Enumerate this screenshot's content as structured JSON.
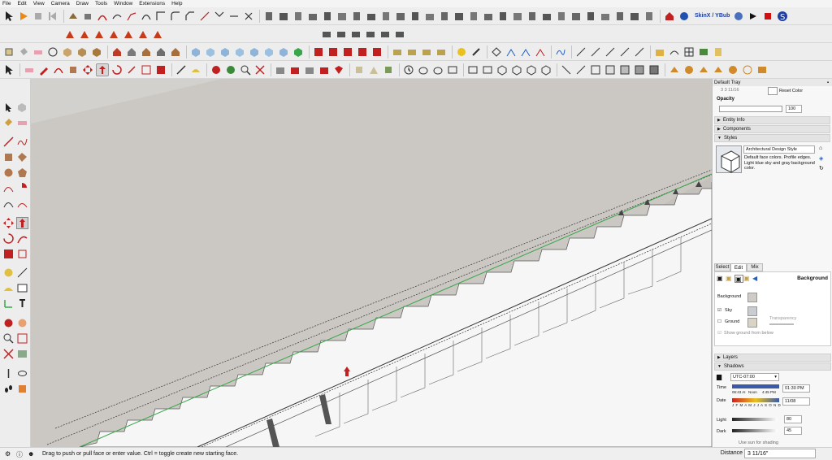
{
  "menu": [
    "File",
    "Edit",
    "View",
    "Camera",
    "Draw",
    "Tools",
    "Window",
    "Extensions",
    "Help"
  ],
  "skin_button": "SkinX / YBub",
  "tray": {
    "title": "Default Tray",
    "reset_color": "Reset Color",
    "opacity_label": "Opacity",
    "opacity_value": "100",
    "entity_info": "Entity Info",
    "components": "Components",
    "styles": "Styles",
    "style_name": "Architectural Design Style",
    "style_desc": "Default face colors. Profile edges. Light blue sky and gray background color.",
    "tabs": [
      "Select",
      "Edit",
      "Mix"
    ],
    "background_label": "Background",
    "bg_row": "Background",
    "sky_row": "Sky",
    "ground_row": "Ground",
    "transparency": "Transparency",
    "show_ground_below": "Show ground from below",
    "layers": "Layers",
    "shadows": "Shadows",
    "timezone": "UTC-07:00",
    "time_label": "Time",
    "time_start": "06:43 AI",
    "time_noon": "Noon",
    "time_end": "4:45 PM",
    "time_value": "01:30 PM",
    "date_label": "Date",
    "months": "J F M A M J J A S O N D",
    "date_value": "11/08",
    "light_label": "Light",
    "light_value": "80",
    "dark_label": "Dark",
    "dark_value": "45",
    "use_sun": "Use sun for shading",
    "fragment": "3 3 11/16"
  },
  "status": {
    "hint": "Drag to push or pull face or enter value.  Ctrl = toggle create new starting face.",
    "measure_label": "Distance",
    "measure_value": "3 11/16\""
  },
  "colors": {
    "viewport_bg": "#cfccc8",
    "sky_swatch": "#c9cdd2",
    "bg_swatch": "#cfcbc6",
    "ground_swatch": "#d9d4c4",
    "green_edge": "#3aa64a",
    "accent_blue": "#1f3f9f"
  }
}
